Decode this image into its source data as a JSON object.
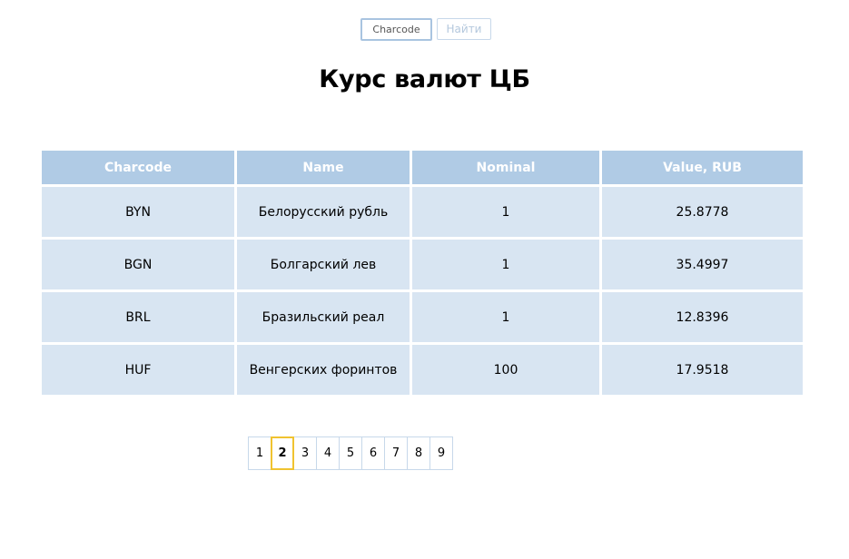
{
  "search": {
    "placeholder": "Charcode",
    "button_label": "Найти"
  },
  "page_title": "Курс валют ЦБ",
  "table": {
    "headers": [
      "Charcode",
      "Name",
      "Nominal",
      "Value, RUB"
    ],
    "rows": [
      {
        "charcode": "BYN",
        "name": "Белорусский рубль",
        "nominal": "1",
        "value": "25.8778"
      },
      {
        "charcode": "BGN",
        "name": "Болгарский лев",
        "nominal": "1",
        "value": "35.4997"
      },
      {
        "charcode": "BRL",
        "name": "Бразильский реал",
        "nominal": "1",
        "value": "12.8396"
      },
      {
        "charcode": "HUF",
        "name": "Венгерских форинтов",
        "nominal": "100",
        "value": "17.9518"
      }
    ]
  },
  "pagination": {
    "pages": [
      "1",
      "2",
      "3",
      "4",
      "5",
      "6",
      "7",
      "8",
      "9"
    ],
    "current_page": "2"
  },
  "colors": {
    "header_bg": "#b0cbe5",
    "cell_bg": "#d8e5f2",
    "active_page_border": "#f0c330"
  }
}
